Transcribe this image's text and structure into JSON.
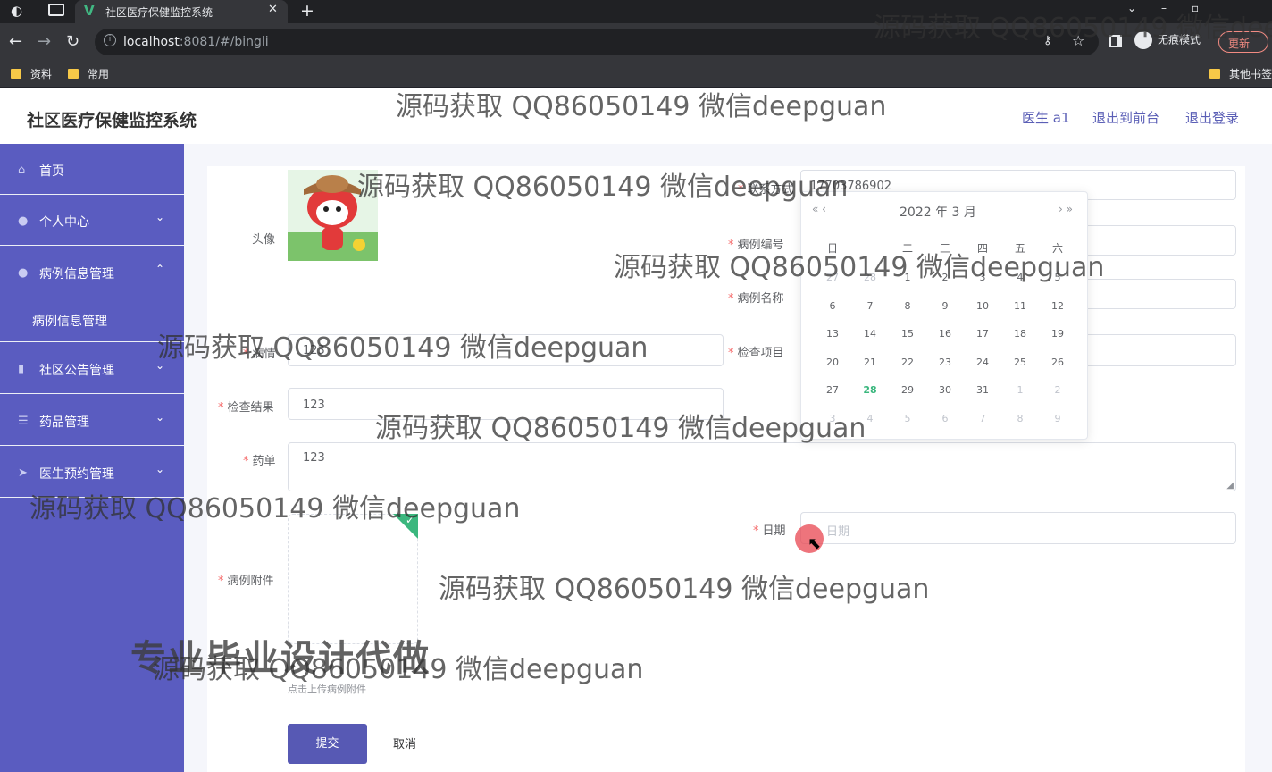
{
  "browser": {
    "tab_title": "社区医疗保健监控系统",
    "tab_close": "✕",
    "new_tab": "+",
    "url_host": "localhost",
    "url_rest": ":8081/#/bingli",
    "incognito_label": "无痕模式",
    "update_label": "更新",
    "bookmarks": [
      "资料",
      "常用"
    ],
    "other_bookmarks": "其他书签"
  },
  "header": {
    "title": "社区医疗保健监控系统",
    "links": [
      "医生 a1",
      "退出到前台",
      "退出登录"
    ]
  },
  "sidebar": {
    "items": [
      {
        "label": "首页",
        "icon": "home-icon"
      },
      {
        "label": "个人中心",
        "icon": "user-icon"
      },
      {
        "label": "病例信息管理",
        "icon": "user-icon"
      },
      {
        "label": "病例信息管理"
      },
      {
        "label": "社区公告管理",
        "icon": "pin-icon"
      },
      {
        "label": "药品管理",
        "icon": "list-icon"
      },
      {
        "label": "医生预约管理",
        "icon": "send-icon"
      }
    ]
  },
  "form": {
    "avatar_label": "头像",
    "contact_label": "联系方式",
    "contact_value": "17703786902",
    "case_no_label": "病例编号",
    "case_name_label": "病例名称",
    "condition_label": "病情",
    "condition_value": "123",
    "check_item_label": "检查项目",
    "check_result_label": "检查结果",
    "check_result_value": "123",
    "prescription_label": "药单",
    "prescription_value": "123",
    "date_label": "日期",
    "date_placeholder": "日期",
    "attachment_label": "病例附件",
    "attachment_hint": "点击上传病例附件",
    "submit_label": "提交",
    "cancel_label": "取消"
  },
  "datepicker": {
    "header": "2022 年  3 月",
    "prev": "« ‹",
    "next": "› »",
    "weekdays": [
      "日",
      "一",
      "二",
      "三",
      "四",
      "五",
      "六"
    ],
    "weeks": [
      [
        "27",
        "28",
        "1",
        "2",
        "3",
        "4",
        "5"
      ],
      [
        "6",
        "7",
        "8",
        "9",
        "10",
        "11",
        "12"
      ],
      [
        "13",
        "14",
        "15",
        "16",
        "17",
        "18",
        "19"
      ],
      [
        "20",
        "21",
        "22",
        "23",
        "24",
        "25",
        "26"
      ],
      [
        "27",
        "28",
        "29",
        "30",
        "31",
        "1",
        "2"
      ],
      [
        "3",
        "4",
        "5",
        "6",
        "7",
        "8",
        "9"
      ]
    ],
    "today": "28"
  },
  "overlay": {
    "watermark": "源码获取 QQ86050149 微信deepguan",
    "corner_watermark": "源码获取 QQ86050149 微信dee",
    "promo": "专业毕业设计代做"
  }
}
